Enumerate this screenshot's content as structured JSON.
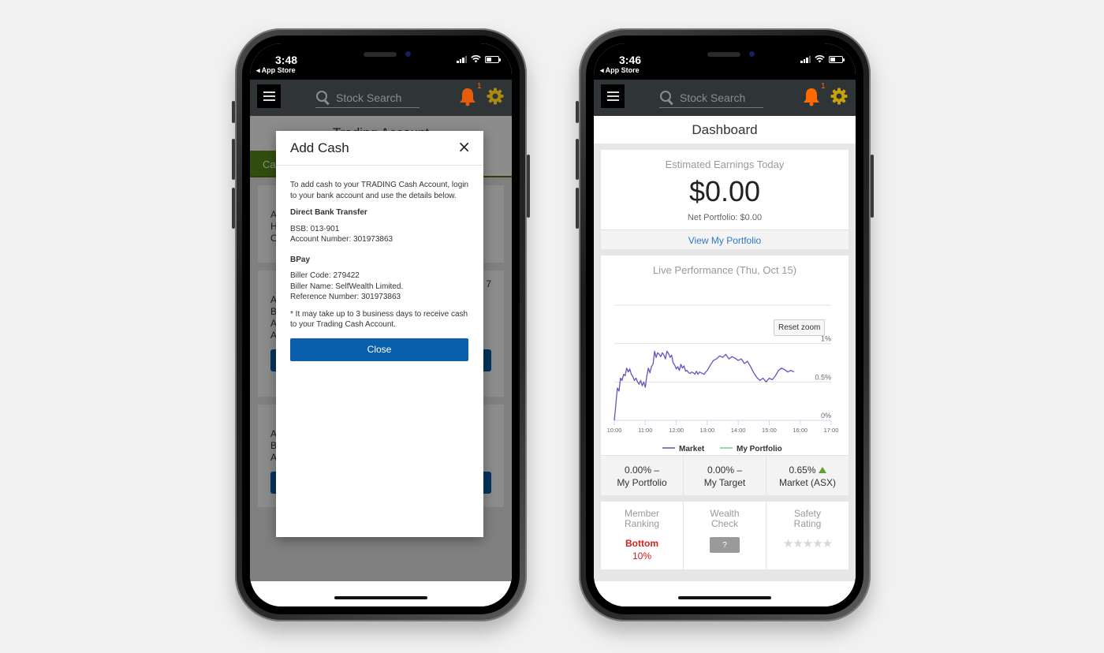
{
  "colors": {
    "accent_blue": "#0a5fac",
    "link_blue": "#2b78c5",
    "tab_green": "#5a8e1c",
    "bell_orange": "#ff6a00",
    "gear_gold": "#c8a20a",
    "market_line": "#6a4fc4",
    "portfolio_line": "#7ccd7c",
    "negative_red": "#d0201e",
    "positive_green": "#5aa22a"
  },
  "left_phone": {
    "status": {
      "time": "3:48",
      "back_label": "◂ App Store"
    },
    "appbar": {
      "search_placeholder": "Stock Search",
      "notification_count": "1"
    },
    "page_title": "Trading Account",
    "tab_active_label": "Cash",
    "background_cards": [
      {
        "lines": [
          "Ac",
          "Ho",
          "Op"
        ],
        "trailing": "7"
      },
      {
        "lines": [
          "Ac",
          "BS",
          "Ac",
          "Av"
        ]
      },
      {
        "lines": [
          "Ac",
          "BS",
          "Ac"
        ]
      }
    ],
    "modal": {
      "title": "Add Cash",
      "close_icon": "×",
      "intro": "To add cash to your TRADING Cash Account, login to your bank account and use the details below.",
      "direct_heading": "Direct Bank Transfer",
      "bsb": "BSB: 013-901",
      "account_number": "Account Number: 301973863",
      "bpay_heading": "BPay",
      "biller_code": "Biller Code: 279422",
      "biller_name": "Biller Name: SelfWealth Limited.",
      "reference_number": "Reference Number: 301973863",
      "note": "* It may take up to 3 business days to receive cash to your Trading Cash Account.",
      "close_button": "Close"
    }
  },
  "right_phone": {
    "status": {
      "time": "3:46",
      "back_label": "◂ App Store"
    },
    "appbar": {
      "search_placeholder": "Stock Search",
      "notification_count": "1"
    },
    "page_title": "Dashboard",
    "earnings": {
      "label": "Estimated Earnings Today",
      "amount": "$0.00",
      "net_portfolio": "Net Portfolio: $0.00",
      "view_link": "View My Portfolio"
    },
    "performance": {
      "title": "Live Performance (Thu, Oct 15)",
      "reset_zoom": "Reset zoom"
    },
    "stats": [
      {
        "value": "0.00% –",
        "label": "My Portfolio"
      },
      {
        "value": "0.00% –",
        "label": "My Target"
      },
      {
        "value": "0.65%",
        "label": "Market (ASX)",
        "trend": "up"
      }
    ],
    "metrics": {
      "member_ranking": {
        "label_1": "Member",
        "label_2": "Ranking",
        "value": "Bottom",
        "pct": "10%"
      },
      "wealth_check": {
        "label_1": "Wealth",
        "label_2": "Check",
        "button": "?"
      },
      "safety_rating": {
        "label_1": "Safety",
        "label_2": "Rating",
        "stars": "★★★★★",
        "rating": 0,
        "max": 5
      }
    }
  },
  "chart_data": {
    "type": "line",
    "title": "Live Performance (Thu, Oct 15)",
    "xlabel": "",
    "ylabel": "",
    "x_ticks": [
      "10:00",
      "11:00",
      "12:00",
      "13:00",
      "14:00",
      "15:00",
      "16:00",
      "17:00"
    ],
    "y_ticks": [
      "0%",
      "0.5%",
      "1%"
    ],
    "ylim": [
      0,
      1.5
    ],
    "xlim_hours": [
      10,
      17
    ],
    "grid": true,
    "legend": {
      "placement": "bottom",
      "entries": [
        "Market",
        "My Portfolio"
      ]
    },
    "series": [
      {
        "name": "Market",
        "x_hours": [
          10.0,
          10.03,
          10.07,
          10.1,
          10.15,
          10.2,
          10.25,
          10.3,
          10.35,
          10.4,
          10.45,
          10.5,
          10.55,
          10.6,
          10.65,
          10.7,
          10.75,
          10.8,
          10.85,
          10.9,
          10.95,
          11.0,
          11.05,
          11.1,
          11.15,
          11.2,
          11.25,
          11.3,
          11.35,
          11.4,
          11.45,
          11.5,
          11.55,
          11.6,
          11.65,
          11.7,
          11.75,
          11.8,
          11.85,
          11.9,
          11.95,
          12.0,
          12.05,
          12.1,
          12.15,
          12.2,
          12.25,
          12.3,
          12.35,
          12.4,
          12.45,
          12.5,
          12.55,
          12.6,
          12.65,
          12.7,
          12.75,
          12.8,
          12.85,
          12.9,
          12.95,
          13.0,
          13.1,
          13.2,
          13.3,
          13.4,
          13.5,
          13.6,
          13.7,
          13.8,
          13.9,
          14.0,
          14.1,
          14.2,
          14.3,
          14.4,
          14.5,
          14.6,
          14.7,
          14.8,
          14.9,
          15.0,
          15.1,
          15.2,
          15.3,
          15.4,
          15.5,
          15.6,
          15.7,
          15.8
        ],
        "values": [
          0.0,
          0.12,
          0.3,
          0.42,
          0.38,
          0.55,
          0.52,
          0.6,
          0.58,
          0.68,
          0.63,
          0.67,
          0.6,
          0.57,
          0.52,
          0.55,
          0.5,
          0.47,
          0.52,
          0.45,
          0.5,
          0.43,
          0.58,
          0.68,
          0.62,
          0.7,
          0.73,
          0.9,
          0.82,
          0.88,
          0.86,
          0.83,
          0.88,
          0.85,
          0.8,
          0.9,
          0.87,
          0.82,
          0.85,
          0.75,
          0.72,
          0.67,
          0.7,
          0.65,
          0.73,
          0.68,
          0.71,
          0.64,
          0.65,
          0.62,
          0.61,
          0.63,
          0.62,
          0.6,
          0.64,
          0.6,
          0.63,
          0.62,
          0.61,
          0.6,
          0.63,
          0.65,
          0.72,
          0.78,
          0.8,
          0.84,
          0.82,
          0.86,
          0.8,
          0.83,
          0.81,
          0.78,
          0.8,
          0.74,
          0.77,
          0.7,
          0.62,
          0.56,
          0.52,
          0.55,
          0.5,
          0.55,
          0.53,
          0.58,
          0.65,
          0.68,
          0.66,
          0.63,
          0.65,
          0.63
        ]
      },
      {
        "name": "My Portfolio",
        "x_hours": [],
        "values": []
      }
    ]
  }
}
